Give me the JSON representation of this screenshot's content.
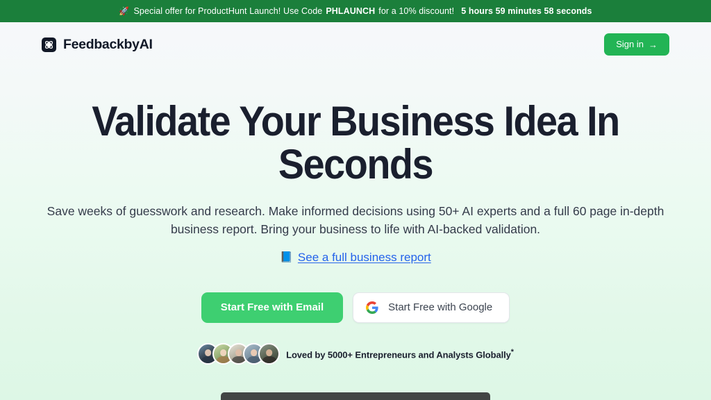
{
  "banner": {
    "icon": "rocket-icon",
    "text_before_code": "Special offer for ProductHunt Launch! Use Code",
    "code": "PHLAUNCH",
    "text_after_code": "for a 10% discount!",
    "timer": "5 hours 59 minutes 58 seconds",
    "background_color": "#1b7f3b",
    "text_color": "#ffffff"
  },
  "header": {
    "brand_name": "FeedbackbyAI",
    "brand_mark_icon": "atom-logo-icon",
    "signin_label": "Sign in",
    "signin_arrow": "→",
    "signin_color": "#22b455"
  },
  "hero": {
    "title": "Validate Your Business Idea In Seconds",
    "subtitle": "Save weeks of guesswork and research. Make informed decisions using 50+ AI experts and a full 60 page in-depth business report. Bring your business to life with AI-backed validation.",
    "report_link_emoji": "📘",
    "report_link_label": "See a full business report",
    "report_link_color": "#2563eb"
  },
  "cta": {
    "email_button_label": "Start Free with Email",
    "email_button_color": "#3ecf71",
    "google_button_label": "Start Free with Google",
    "google_icon": "google-g-icon"
  },
  "social_proof": {
    "text": "Loved by 5000+ Entrepreneurs and Analysts Globally",
    "superscript": "*",
    "avatar_count": 5,
    "avatars": [
      {
        "name": "avatar-1"
      },
      {
        "name": "avatar-2"
      },
      {
        "name": "avatar-3"
      },
      {
        "name": "avatar-4"
      },
      {
        "name": "avatar-5"
      }
    ]
  },
  "media": {
    "video_frame_color": "#424545"
  }
}
